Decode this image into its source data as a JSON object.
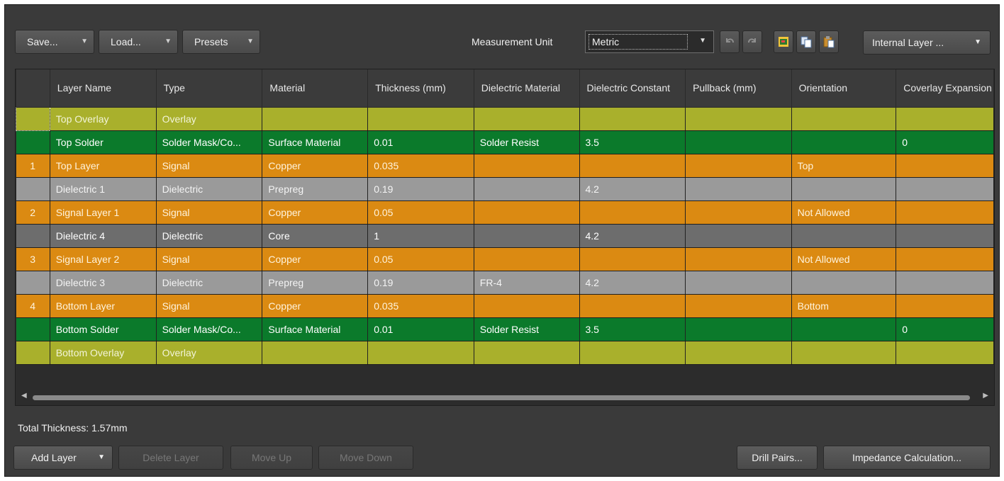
{
  "toolbar": {
    "save_label": "Save...",
    "load_label": "Load...",
    "presets_label": "Presets",
    "measurement_label": "Measurement Unit",
    "measurement_value": "Metric",
    "internal_layer_label": "Internal Layer ...",
    "icons": [
      "undo-icon",
      "redo-icon",
      "layer-properties-icon",
      "copy-icon",
      "paste-icon"
    ]
  },
  "grid": {
    "columns": [
      "",
      "Layer Name",
      "Type",
      "Material",
      "Thickness (mm)",
      "Dielectric Material",
      "Dielectric Constant",
      "Pullback (mm)",
      "Orientation",
      "Coverlay Expansion"
    ],
    "rows": [
      {
        "kind": "overlay",
        "cells": [
          "",
          "Top Overlay",
          "Overlay",
          "",
          "",
          "",
          "",
          "",
          "",
          ""
        ]
      },
      {
        "kind": "solder",
        "cells": [
          "",
          "Top Solder",
          "Solder Mask/Co...",
          "Surface Material",
          "0.01",
          "Solder Resist",
          "3.5",
          "",
          "",
          "0"
        ]
      },
      {
        "kind": "signal",
        "cells": [
          "1",
          "Top Layer",
          "Signal",
          "Copper",
          "0.035",
          "",
          "",
          "",
          "Top",
          ""
        ]
      },
      {
        "kind": "dielectric-light",
        "cells": [
          "",
          "Dielectric 1",
          "Dielectric",
          "Prepreg",
          "0.19",
          "",
          "4.2",
          "",
          "",
          ""
        ]
      },
      {
        "kind": "signal",
        "cells": [
          "2",
          "Signal Layer 1",
          "Signal",
          "Copper",
          "0.05",
          "",
          "",
          "",
          "Not Allowed",
          ""
        ]
      },
      {
        "kind": "dielectric-dark",
        "cells": [
          "",
          "Dielectric 4",
          "Dielectric",
          "Core",
          "1",
          "",
          "4.2",
          "",
          "",
          ""
        ]
      },
      {
        "kind": "signal",
        "cells": [
          "3",
          "Signal Layer 2",
          "Signal",
          "Copper",
          "0.05",
          "",
          "",
          "",
          "Not Allowed",
          ""
        ]
      },
      {
        "kind": "dielectric-light",
        "cells": [
          "",
          "Dielectric 3",
          "Dielectric",
          "Prepreg",
          "0.19",
          "FR-4",
          "4.2",
          "",
          "",
          ""
        ]
      },
      {
        "kind": "signal",
        "cells": [
          "4",
          "Bottom Layer",
          "Signal",
          "Copper",
          "0.035",
          "",
          "",
          "",
          "Bottom",
          ""
        ]
      },
      {
        "kind": "solder",
        "cells": [
          "",
          "Bottom Solder",
          "Solder Mask/Co...",
          "Surface Material",
          "0.01",
          "Solder Resist",
          "3.5",
          "",
          "",
          "0"
        ]
      },
      {
        "kind": "overlay",
        "cells": [
          "",
          "Bottom Overlay",
          "Overlay",
          "",
          "",
          "",
          "",
          "",
          "",
          ""
        ]
      }
    ]
  },
  "total_thickness": "Total Thickness: 1.57mm",
  "bottom": {
    "add_layer_label": "Add Layer",
    "delete_layer_label": "Delete Layer",
    "move_up_label": "Move Up",
    "move_down_label": "Move Down",
    "drill_pairs_label": "Drill Pairs...",
    "impedance_label": "Impedance Calculation..."
  },
  "colors": {
    "overlay": "#a9b02c",
    "solder": "#0b7a2b",
    "signal": "#db8a12",
    "dielectric_light": "#9a9a9a",
    "dielectric_dark": "#6d6d6d"
  }
}
